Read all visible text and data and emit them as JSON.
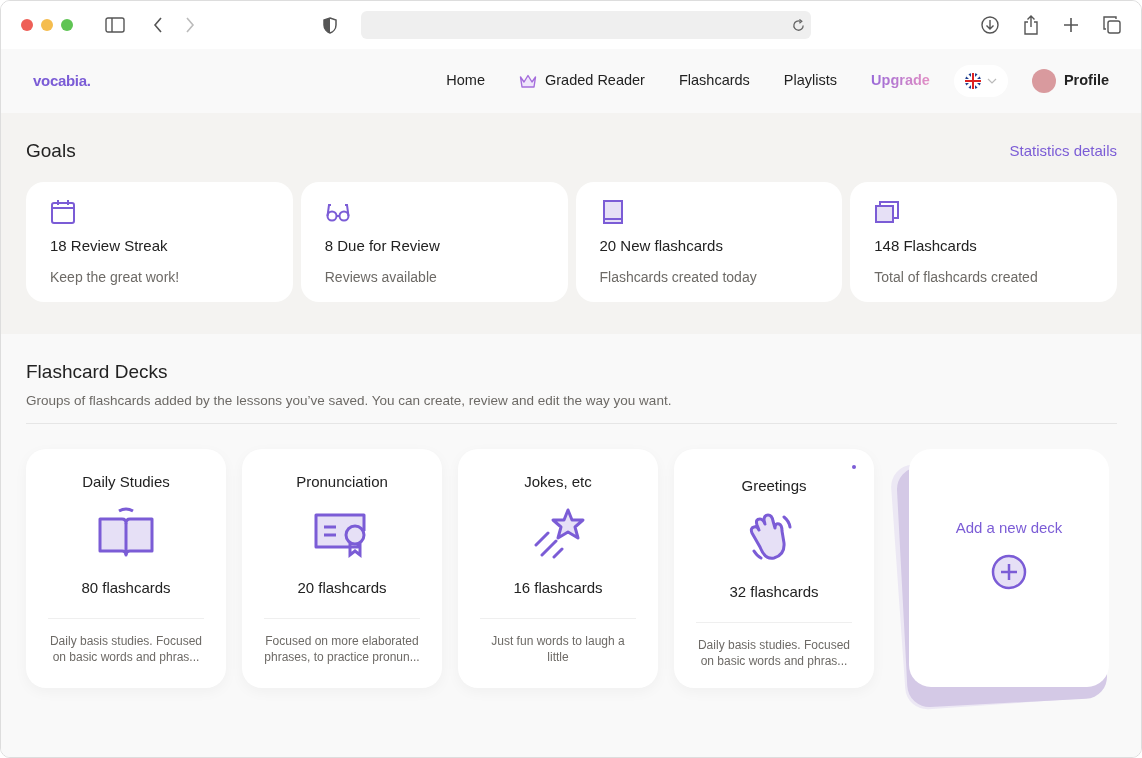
{
  "nav": {
    "logo": "vocabia.",
    "items": [
      {
        "label": "Home",
        "kind": "link"
      },
      {
        "label": "Graded Reader",
        "kind": "premium"
      },
      {
        "label": "Flashcards",
        "kind": "link"
      },
      {
        "label": "Playlists",
        "kind": "link"
      },
      {
        "label": "Upgrade",
        "kind": "upgrade"
      }
    ],
    "profile": "Profile"
  },
  "goals": {
    "title": "Goals",
    "link": "Statistics details",
    "cards": [
      {
        "kind": "calendar",
        "title": "18 Review Streak",
        "subtitle": "Keep the great work!"
      },
      {
        "kind": "glasses",
        "title": "8 Due for Review",
        "subtitle": "Reviews available"
      },
      {
        "kind": "book",
        "title": "20 New flashcards",
        "subtitle": "Flashcards created today"
      },
      {
        "kind": "cards",
        "title": "148 Flashcards",
        "subtitle": "Total of flashcards created"
      }
    ]
  },
  "decks": {
    "title": "Flashcard Decks",
    "subtitle": "Groups of flashcards added by the lessons you’ve saved. You can create, review and edit the way you want.",
    "items": [
      {
        "name": "Daily Studies",
        "kind": "open-book",
        "count": "80 flashcards",
        "description": "Daily basis studies. Focused on basic words and phras...",
        "raised": false
      },
      {
        "name": "Pronunciation",
        "kind": "certificate",
        "count": "20 flashcards",
        "description": "Focused on more elaborated phrases, to practice pronun...",
        "raised": false
      },
      {
        "name": "Jokes, etc",
        "kind": "star",
        "count": "16 flashcards",
        "description": "Just fun words to laugh a little",
        "raised": false
      },
      {
        "name": "Greetings",
        "kind": "hand",
        "count": "32 flashcards",
        "description": "Daily basis studies. Focused on basic words and phras...",
        "raised": true
      }
    ],
    "add_label": "Add a new deck"
  }
}
